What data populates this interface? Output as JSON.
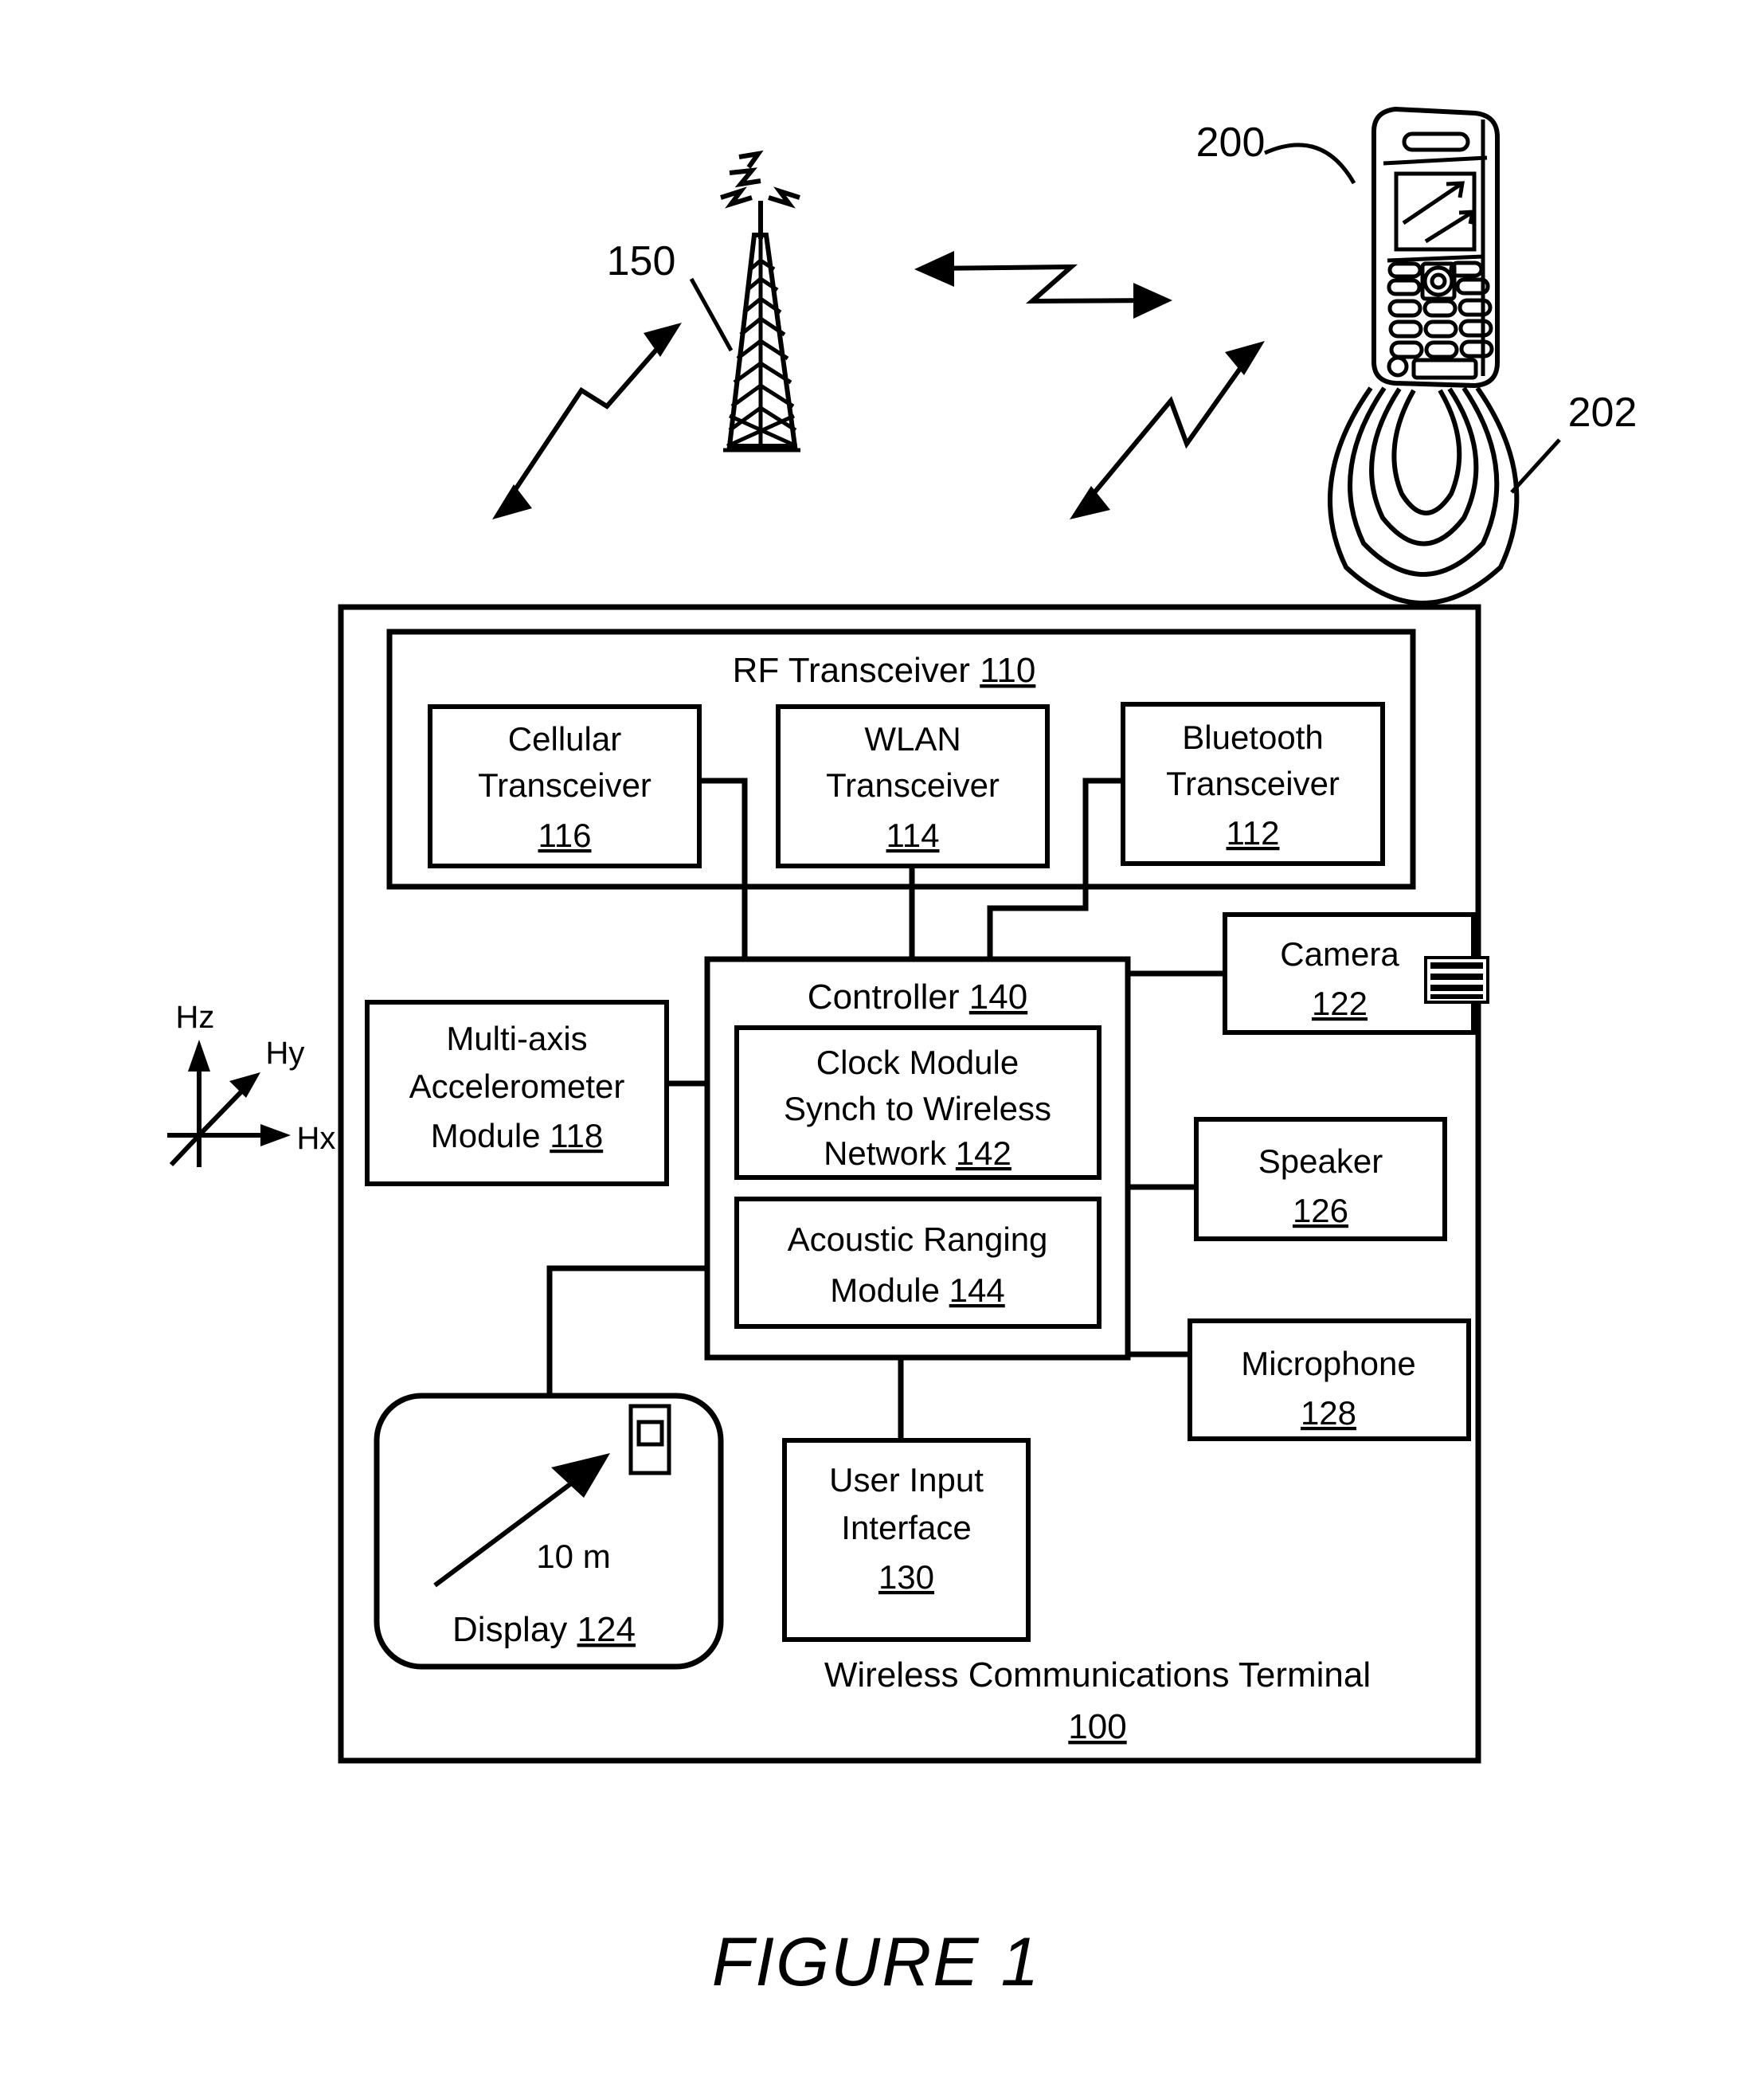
{
  "figure": {
    "caption": "FIGURE 1"
  },
  "scene": {
    "tower_label": "150",
    "handset_label": "200",
    "acoustic_wave_label": "202"
  },
  "axes": {
    "z": "Hz",
    "y": "Hy",
    "x": "Hx"
  },
  "terminal": {
    "title": "Wireless Communications Terminal",
    "ref": "100"
  },
  "rf_transceiver": {
    "title": "RF Transceiver",
    "ref": "110",
    "children": [
      {
        "line1": "Cellular",
        "line2": "Transceiver",
        "ref": "116"
      },
      {
        "line1": "WLAN",
        "line2": "Transceiver",
        "ref": "114"
      },
      {
        "line1": "Bluetooth",
        "line2": "Transceiver",
        "ref": "112"
      }
    ]
  },
  "controller": {
    "title": "Controller",
    "ref": "140",
    "modules": [
      {
        "line1": "Clock Module",
        "line2": "Synch to Wireless",
        "line3": "Network",
        "ref": "142"
      },
      {
        "line1": "Acoustic Ranging",
        "line2": "Module",
        "ref": "144"
      }
    ]
  },
  "accelerometer": {
    "line1": "Multi-axis",
    "line2": "Accelerometer",
    "line3": "Module",
    "ref": "118"
  },
  "display": {
    "label": "Display",
    "ref": "124",
    "distance": "10 m"
  },
  "user_input": {
    "line1": "User Input",
    "line2": "Interface",
    "ref": "130"
  },
  "camera": {
    "label": "Camera",
    "ref": "122"
  },
  "speaker": {
    "label": "Speaker",
    "ref": "126"
  },
  "microphone": {
    "label": "Microphone",
    "ref": "128"
  }
}
